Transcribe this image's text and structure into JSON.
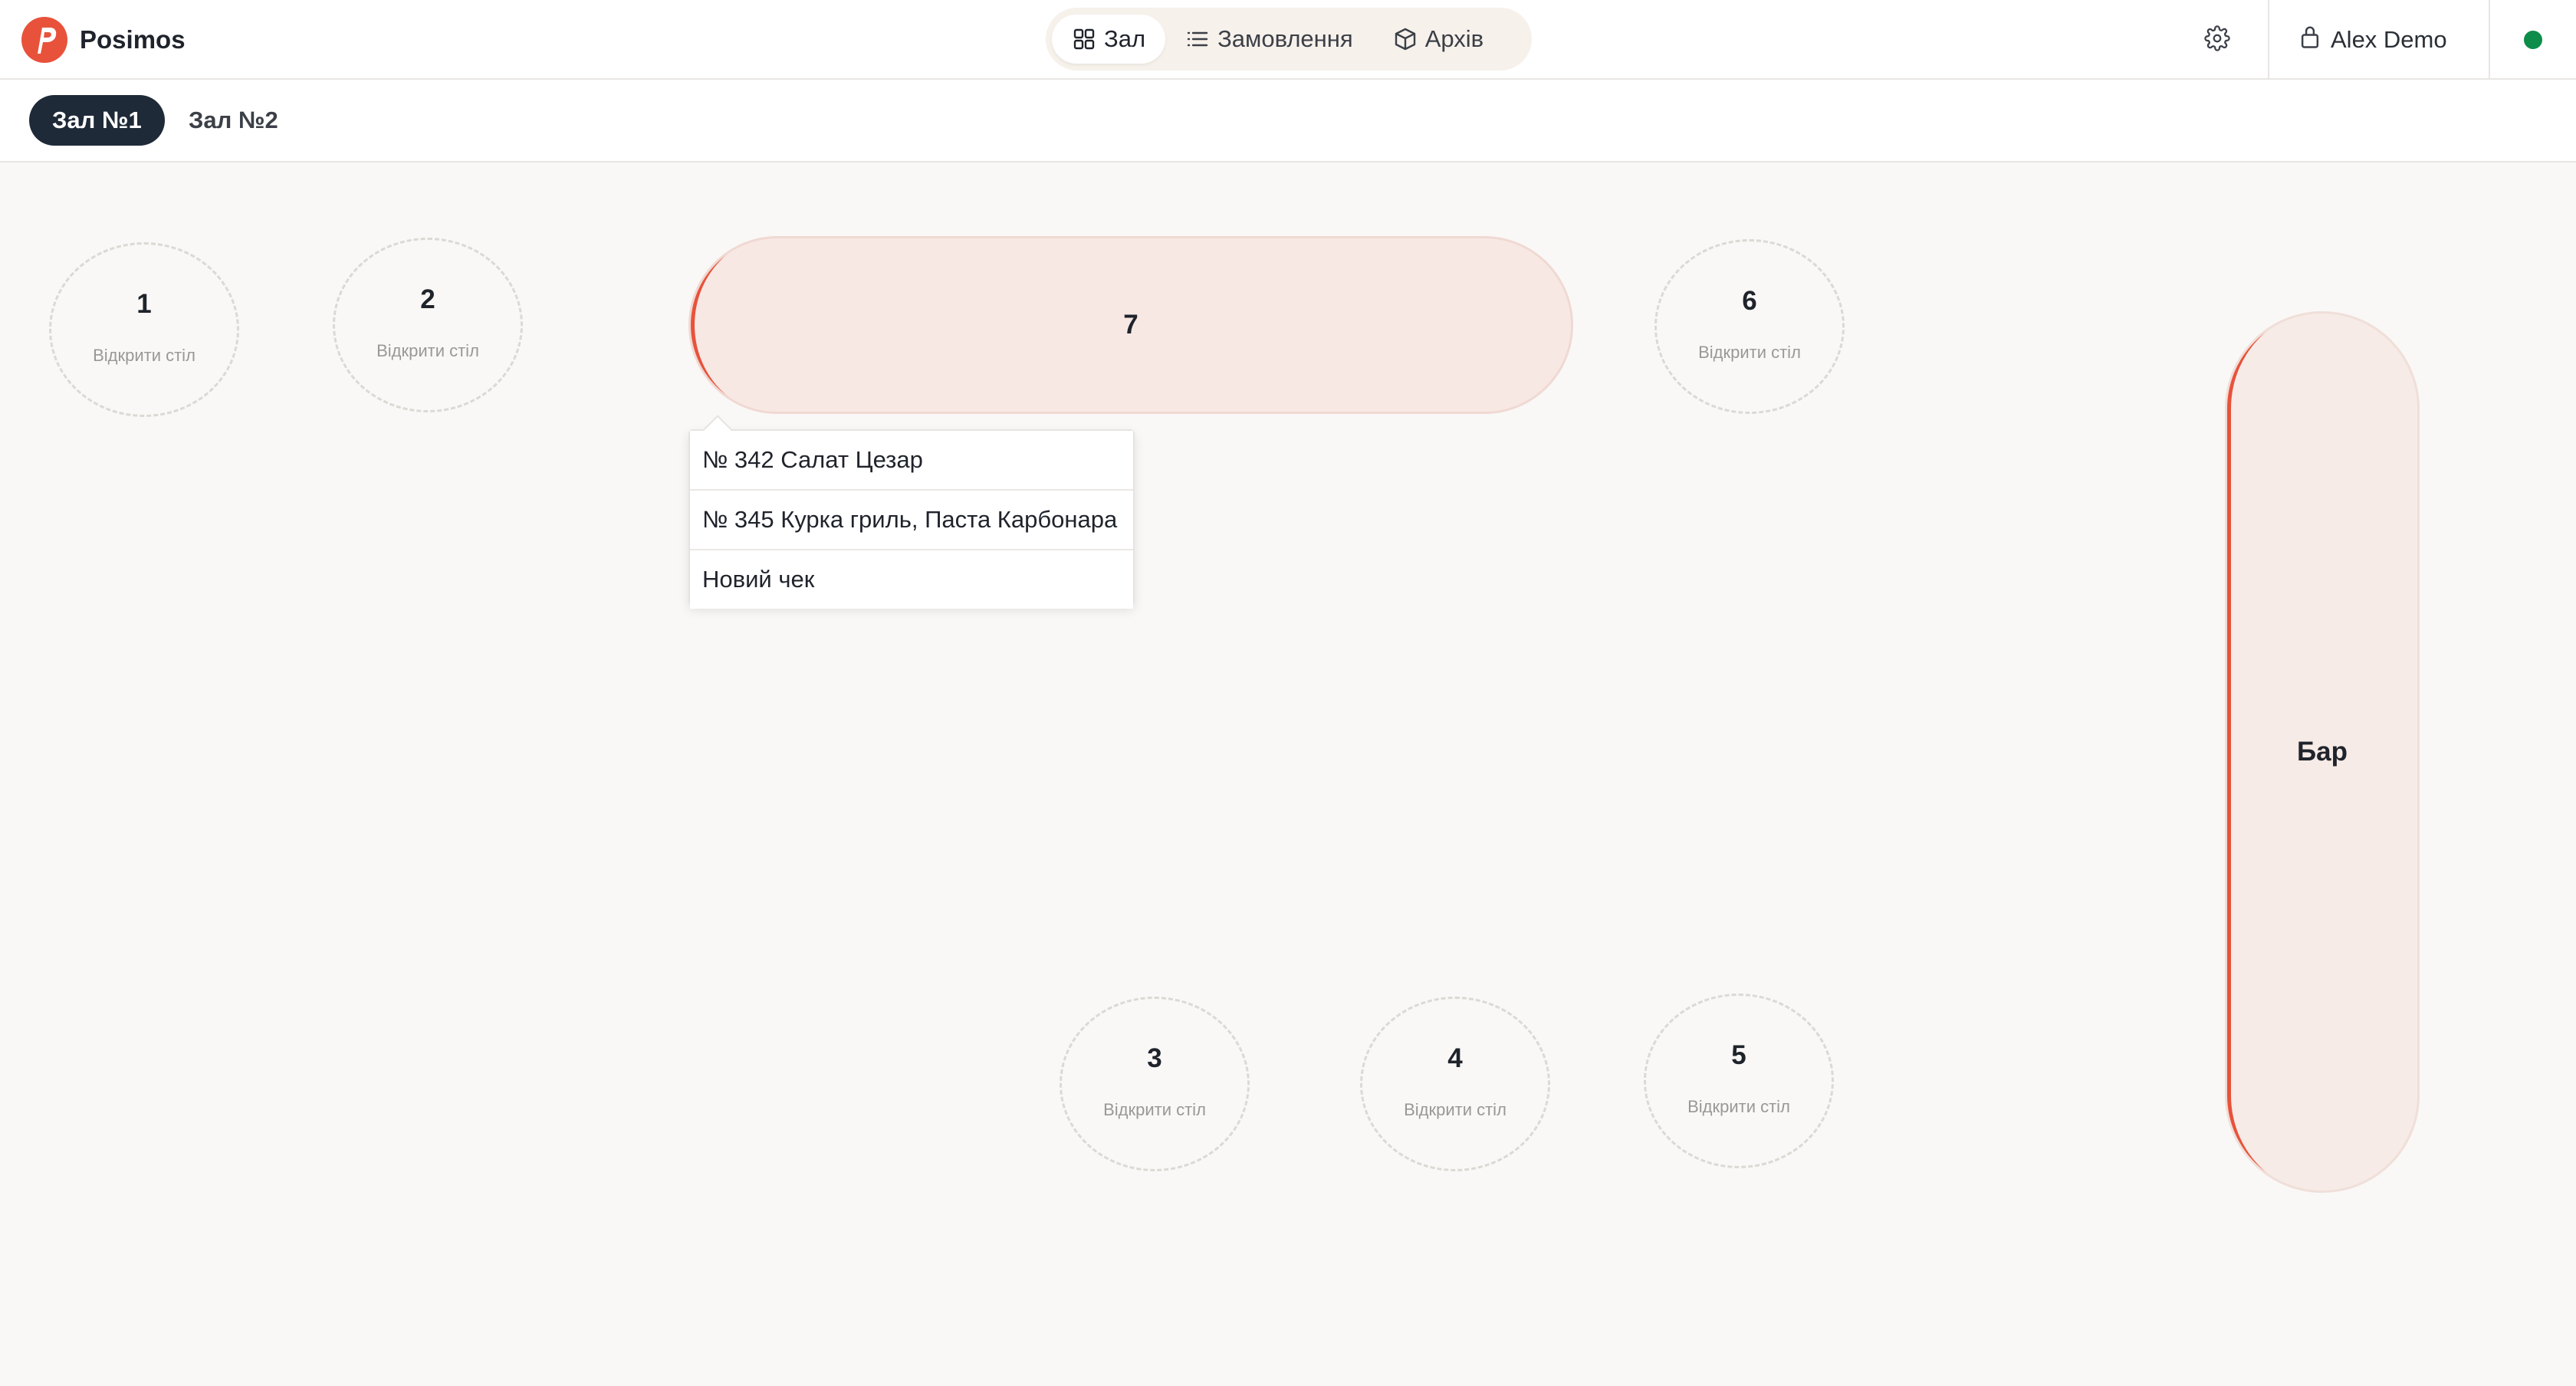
{
  "app": {
    "name": "Posimos",
    "logo_icon": "posimos-logo-icon",
    "brand_color": "#e8523b"
  },
  "nav": {
    "items": [
      {
        "label": "Зал",
        "icon": "grid-icon",
        "active": true
      },
      {
        "label": "Замовлення",
        "icon": "list-icon",
        "active": false
      },
      {
        "label": "Архів",
        "icon": "box-icon",
        "active": false
      }
    ]
  },
  "header": {
    "settings_icon": "gear-icon",
    "user_name": "Alex Demo",
    "user_icon": "lock-icon",
    "status_color": "#0e8c4a"
  },
  "halls": {
    "tabs": [
      {
        "label": "Зал №1",
        "active": true
      },
      {
        "label": "Зал №2",
        "active": false
      }
    ]
  },
  "floor": {
    "open_label": "Відкрити стіл",
    "tables": {
      "t1": {
        "number": "1"
      },
      "t2": {
        "number": "2"
      },
      "t3": {
        "number": "3"
      },
      "t4": {
        "number": "4"
      },
      "t5": {
        "number": "5"
      },
      "t6": {
        "number": "6"
      },
      "t7": {
        "number": "7"
      },
      "bar": {
        "number": "Бар"
      }
    }
  },
  "popover": {
    "items": [
      "№ 342 Салат Цезар",
      "№ 345 Курка гриль, Паста Карбонара",
      "Новий чек"
    ]
  }
}
